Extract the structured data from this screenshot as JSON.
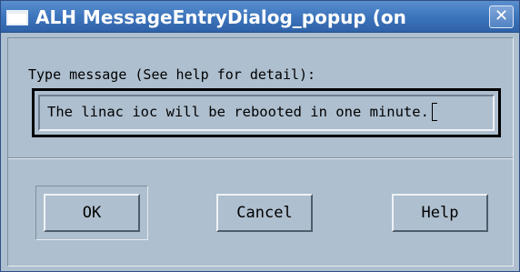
{
  "window": {
    "title": "ALH MessageEntryDialog_popup (on",
    "close_glyph": "✕"
  },
  "dialog": {
    "prompt": "Type message (See help for detail):",
    "message_value": "The linac ioc will be rebooted in one minute."
  },
  "buttons": {
    "ok_label": "OK",
    "cancel_label": "Cancel",
    "help_label": "Help"
  },
  "colors": {
    "titlebar": "#3b73bb",
    "dialog_background": "#aebfcf"
  }
}
